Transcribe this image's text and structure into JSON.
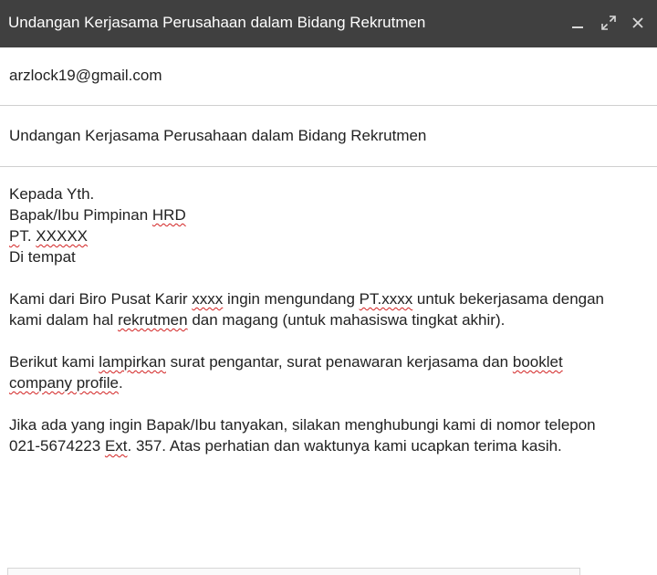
{
  "window": {
    "title": "Undangan Kerjasama Perusahaan dalam Bidang Rekrutmen",
    "controls": {
      "minimize": "minimize-icon",
      "expand": "expand-icon",
      "close": "close-icon"
    }
  },
  "compose": {
    "to": "arzlock19@gmail.com",
    "subject": "Undangan Kerjasama Perusahaan dalam Bidang Rekrutmen",
    "body": {
      "line1": "Kepada Yth.",
      "line2_a": "Bapak/Ibu Pimpinan ",
      "line2_b": "HRD",
      "line3_a": "P",
      "line3_b": "T. ",
      "line3_c": "XXXXX",
      "line4": "Di tempat",
      "para1_a": "Kami dari Biro Pusat Karir ",
      "para1_b": "xxxx",
      "para1_c": " ingin mengundang ",
      "para1_d": "PT.xxxx",
      "para1_e": " untuk bekerjasama dengan",
      "para1_f": "kami dalam hal ",
      "para1_g": "rekrutmen",
      "para1_h": " dan magang (untuk mahasiswa tingkat akhir).",
      "para2_a": "Berikut kami ",
      "para2_b": "lampirkan",
      "para2_c": " surat pengantar, surat penawaran kerjasama dan ",
      "para2_d": "booklet",
      "para2_e": "company profile",
      "para2_f": ".",
      "para3_a": "Jika ada yang ingin Bapak/Ibu tanyakan, silakan menghubungi kami di nomor telepon",
      "para3_b": "021-5674223 ",
      "para3_c": "Ext",
      "para3_d": ". 357. Atas perhatian dan waktunya kami ucapkan terima kasih."
    }
  },
  "colors": {
    "titlebar": "#404040",
    "spellcheck": "#d22222"
  }
}
